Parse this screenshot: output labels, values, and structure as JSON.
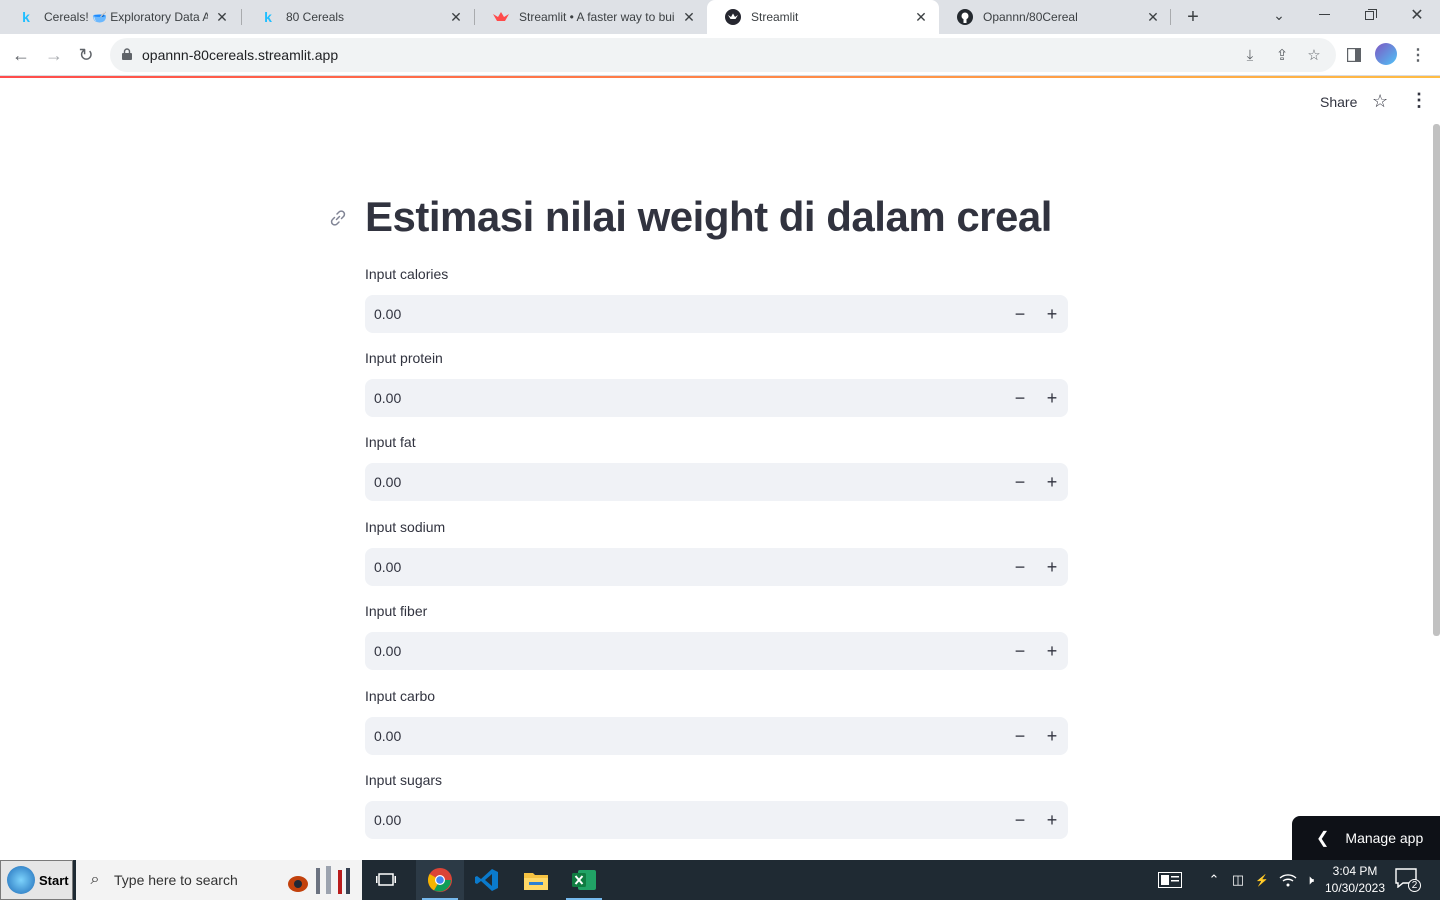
{
  "browser": {
    "tabs": [
      {
        "title": "Cereals! 🥣 Exploratory Data Analysis",
        "favicon": "kaggle-icon",
        "active": false
      },
      {
        "title": "80 Cereals",
        "favicon": "kaggle-icon",
        "active": false
      },
      {
        "title": "Streamlit • A faster way to build",
        "favicon": "streamlit-crown-icon",
        "active": false
      },
      {
        "title": "Streamlit",
        "favicon": "streamlit-icon",
        "active": true
      },
      {
        "title": "Opannn/80Cereal",
        "favicon": "github-icon",
        "active": false
      }
    ],
    "kaggle_letter": "k",
    "url": "opannn-80cereals.streamlit.app"
  },
  "header": {
    "share_label": "Share"
  },
  "app": {
    "title": "Estimasi nilai weight di dalam creal",
    "fields": [
      {
        "label": "Input calories",
        "value": "0.00"
      },
      {
        "label": "Input protein",
        "value": "0.00"
      },
      {
        "label": "Input fat",
        "value": "0.00"
      },
      {
        "label": "Input sodium",
        "value": "0.00"
      },
      {
        "label": "Input fiber",
        "value": "0.00"
      },
      {
        "label": "Input carbo",
        "value": "0.00"
      },
      {
        "label": "Input sugars",
        "value": "0.00"
      }
    ],
    "minus_label": "−",
    "plus_label": "+",
    "manage_label": "Manage app"
  },
  "taskbar": {
    "start_label": "Start",
    "search_placeholder": "Type here to search",
    "time": "3:04 PM",
    "date": "10/30/2023",
    "notification_count": "2"
  },
  "colors": {
    "accent": "#ff4b4b",
    "input_bg": "#f0f2f6",
    "text": "#31333f",
    "taskbar": "#1f2a33"
  }
}
